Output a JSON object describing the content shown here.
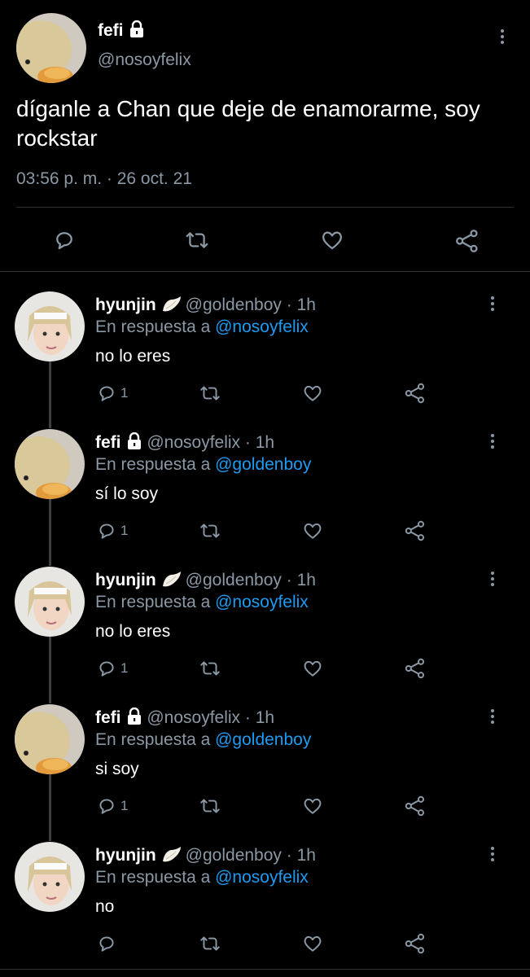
{
  "main_tweet": {
    "name": "fefi",
    "handle": "@nosoyfelix",
    "text": "díganle a Chan que deje de enamorarme, soy rockstar",
    "timestamp": "03:56 p. m. · 26 oct. 21",
    "actions": [
      "reply-icon",
      "retweet-icon",
      "like-icon",
      "share-icon"
    ]
  },
  "replies": [
    {
      "name": "hyunjin",
      "badge": "wing",
      "meta": "@goldenboy · 1h",
      "reply_prefix": "En respuesta a",
      "reply_to": "@nosoyfelix",
      "text": "no lo eres",
      "reply_count": "1",
      "avatar": "person"
    },
    {
      "name": "fefi",
      "badge": "lock",
      "meta": "@nosoyfelix · 1h",
      "reply_prefix": "En respuesta a",
      "reply_to": "@goldenboy",
      "text": "sí lo soy",
      "reply_count": "1",
      "avatar": "duck"
    },
    {
      "name": "hyunjin",
      "badge": "wing",
      "meta": "@goldenboy · 1h",
      "reply_prefix": "En respuesta a",
      "reply_to": "@nosoyfelix",
      "text": "no lo eres",
      "reply_count": "1",
      "avatar": "person"
    },
    {
      "name": "fefi",
      "badge": "lock",
      "meta": "@nosoyfelix · 1h",
      "reply_prefix": "En respuesta a",
      "reply_to": "@goldenboy",
      "text": "si soy",
      "reply_count": "1",
      "avatar": "duck"
    },
    {
      "name": "hyunjin",
      "badge": "wing",
      "meta": "@goldenboy · 1h",
      "reply_prefix": "En respuesta a",
      "reply_to": "@nosoyfelix",
      "text": "no",
      "reply_count": "",
      "avatar": "person"
    }
  ],
  "colors": {
    "background": "#000000",
    "text": "#ffffff",
    "secondary": "#8b98a5",
    "mention": "#1d9bf0",
    "divider": "#2f3336"
  }
}
